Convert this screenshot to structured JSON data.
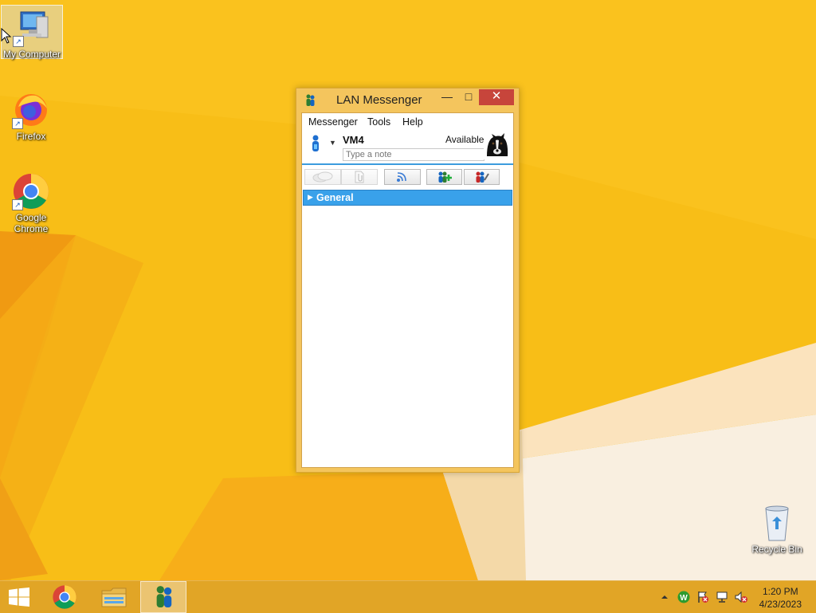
{
  "desktop": {
    "icons": [
      {
        "label": "My Computer"
      },
      {
        "label": "Firefox"
      },
      {
        "label": "Google Chrome"
      },
      {
        "label": "Recycle Bin"
      }
    ]
  },
  "window": {
    "title": "LAN Messenger",
    "menu": [
      "Messenger",
      "Tools",
      "Help"
    ],
    "user": {
      "name": "VM4",
      "status": "Available",
      "note_placeholder": "Type a note"
    },
    "group": {
      "label": "General"
    }
  },
  "taskbar": {
    "time": "1:20 PM",
    "date": "4/23/2023"
  },
  "colors": {
    "wallpaper": "#f6b912",
    "accent_blue": "#39a1ea",
    "close_red": "#c7453b"
  }
}
